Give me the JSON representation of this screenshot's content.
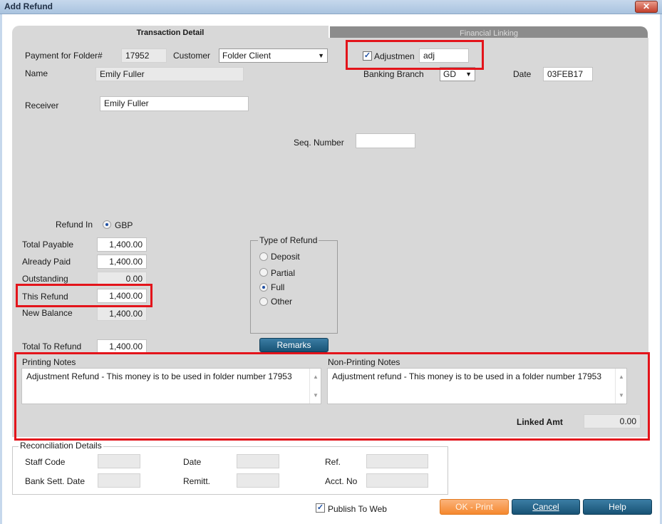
{
  "window": {
    "title": "Add Refund",
    "close_label": "✕"
  },
  "tabs": {
    "transaction_detail": "Transaction Detail",
    "financial_linking": "Financial Linking"
  },
  "header": {
    "payment_for_folder_label": "Payment for Folder#",
    "payment_for_folder_value": "17952",
    "customer_label": "Customer",
    "customer_value": "Folder Client",
    "name_label": "Name",
    "name_value": "Emily Fuller",
    "receiver_label": "Receiver",
    "receiver_value": "Emily Fuller",
    "adjustment_label": "Adjustmen",
    "adjustment_value": "adj",
    "banking_branch_label": "Banking Branch",
    "banking_branch_value": "GD",
    "date_label": "Date",
    "date_value": "03FEB17",
    "seq_number_label": "Seq. Number",
    "seq_number_value": ""
  },
  "amounts": {
    "refund_in_label": "Refund In",
    "refund_in_value": "GBP",
    "total_payable_label": "Total Payable",
    "total_payable_value": "1,400.00",
    "already_paid_label": "Already Paid",
    "already_paid_value": "1,400.00",
    "outstanding_label": "Outstanding",
    "outstanding_value": "0.00",
    "this_refund_label": "This Refund",
    "this_refund_value": "1,400.00",
    "new_balance_label": "New Balance",
    "new_balance_value": "1,400.00",
    "total_to_refund_label": "Total To Refund",
    "total_to_refund_value": "1,400.00"
  },
  "type_of_refund": {
    "legend": "Type of Refund",
    "options": [
      "Deposit",
      "Partial",
      "Full",
      "Other"
    ],
    "selected": "Full"
  },
  "remarks_button": "Remarks",
  "notes": {
    "printing_label": "Printing Notes",
    "printing_text": "Adjustment Refund - This money is to be used in folder number 17953",
    "non_printing_label": "Non-Printing Notes",
    "non_printing_text": "Adjustment refund - This money is to be used in a folder number 17953",
    "linked_amt_label": "Linked Amt",
    "linked_amt_value": "0.00"
  },
  "reconciliation": {
    "legend": "Reconciliation Details",
    "staff_code_label": "Staff Code",
    "date_label": "Date",
    "ref_label": "Ref.",
    "bank_sett_date_label": "Bank Sett. Date",
    "remitt_label": "Remitt.",
    "acct_no_label": "Acct. No"
  },
  "footer": {
    "publish_to_web_label": "Publish To Web",
    "ok_print_label": "OK - Print",
    "cancel_label": "Cancel",
    "help_label": "Help"
  },
  "colors": {
    "highlight": "#e3141b",
    "panel": "#d8d8d8",
    "button_blue": "#185375",
    "button_orange": "#f5882e"
  }
}
